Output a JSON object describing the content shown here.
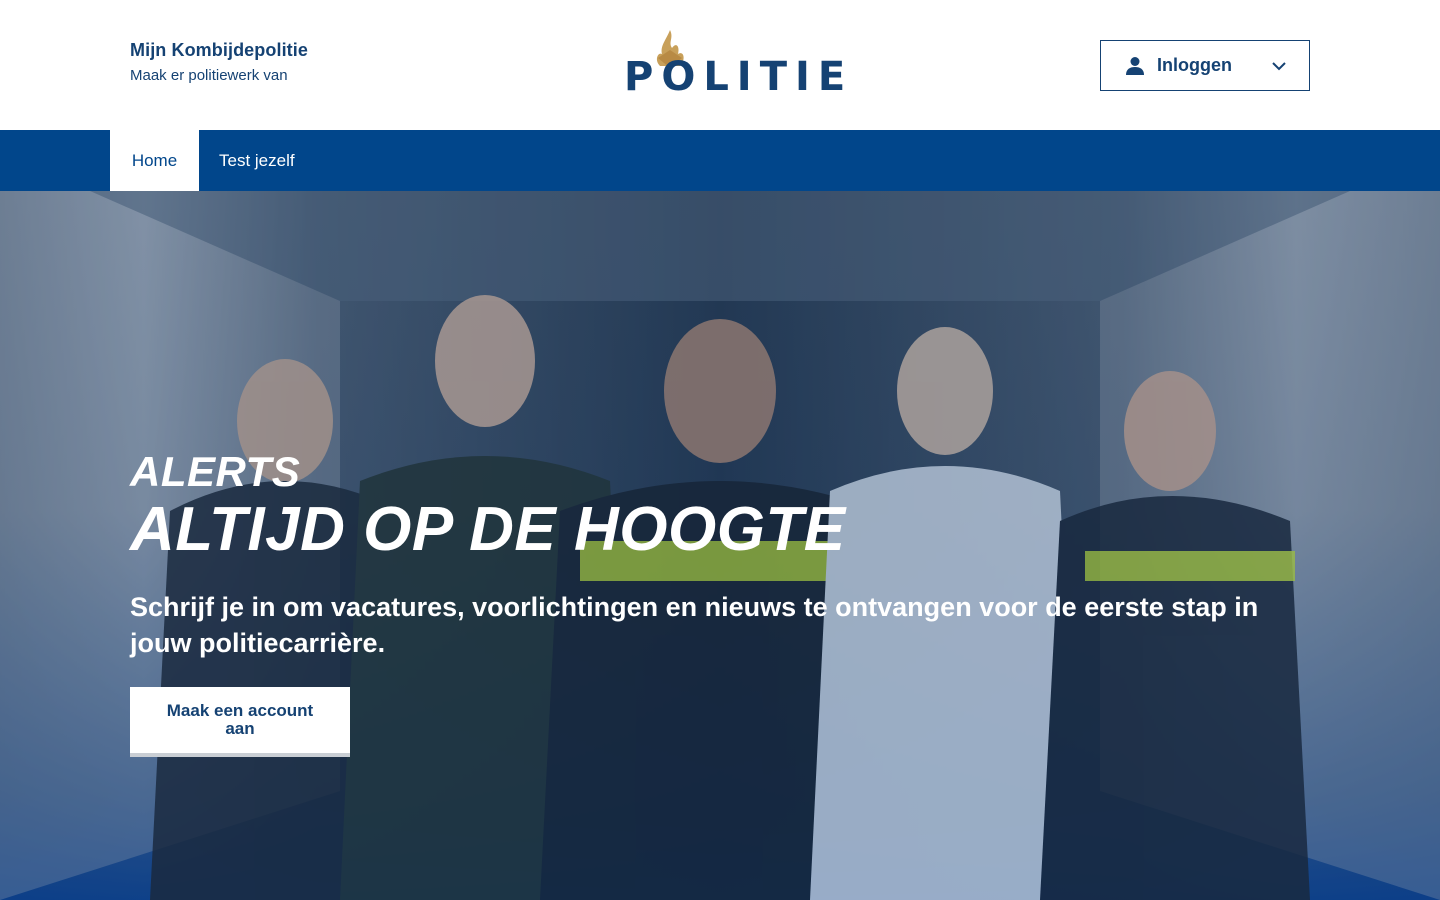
{
  "header": {
    "brand_title": "Mijn Kombijdepolitie",
    "brand_subtitle": "Maak er politiewerk van",
    "logo_text": "POLITIE",
    "login_label": "Inloggen"
  },
  "nav": {
    "items": [
      {
        "label": "Home",
        "active": true
      },
      {
        "label": "Test jezelf",
        "active": false
      }
    ]
  },
  "hero": {
    "eyebrow": "ALERTS",
    "headline": "ALTIJD OP DE HOOGTE",
    "lead": "Schrijf je in om vacatures, voorlichtingen en nieuws te ontvangen voor de eerste stap in jouw politiecarrière.",
    "cta_label": "Maak een account aan"
  },
  "colors": {
    "brand_blue": "#154273",
    "nav_blue": "#01468b",
    "logo_gold": "#c8a05a",
    "white": "#ffffff"
  },
  "icons": {
    "logo": "police-flame-icon",
    "login": "user-icon",
    "dropdown": "chevron-down-icon"
  }
}
